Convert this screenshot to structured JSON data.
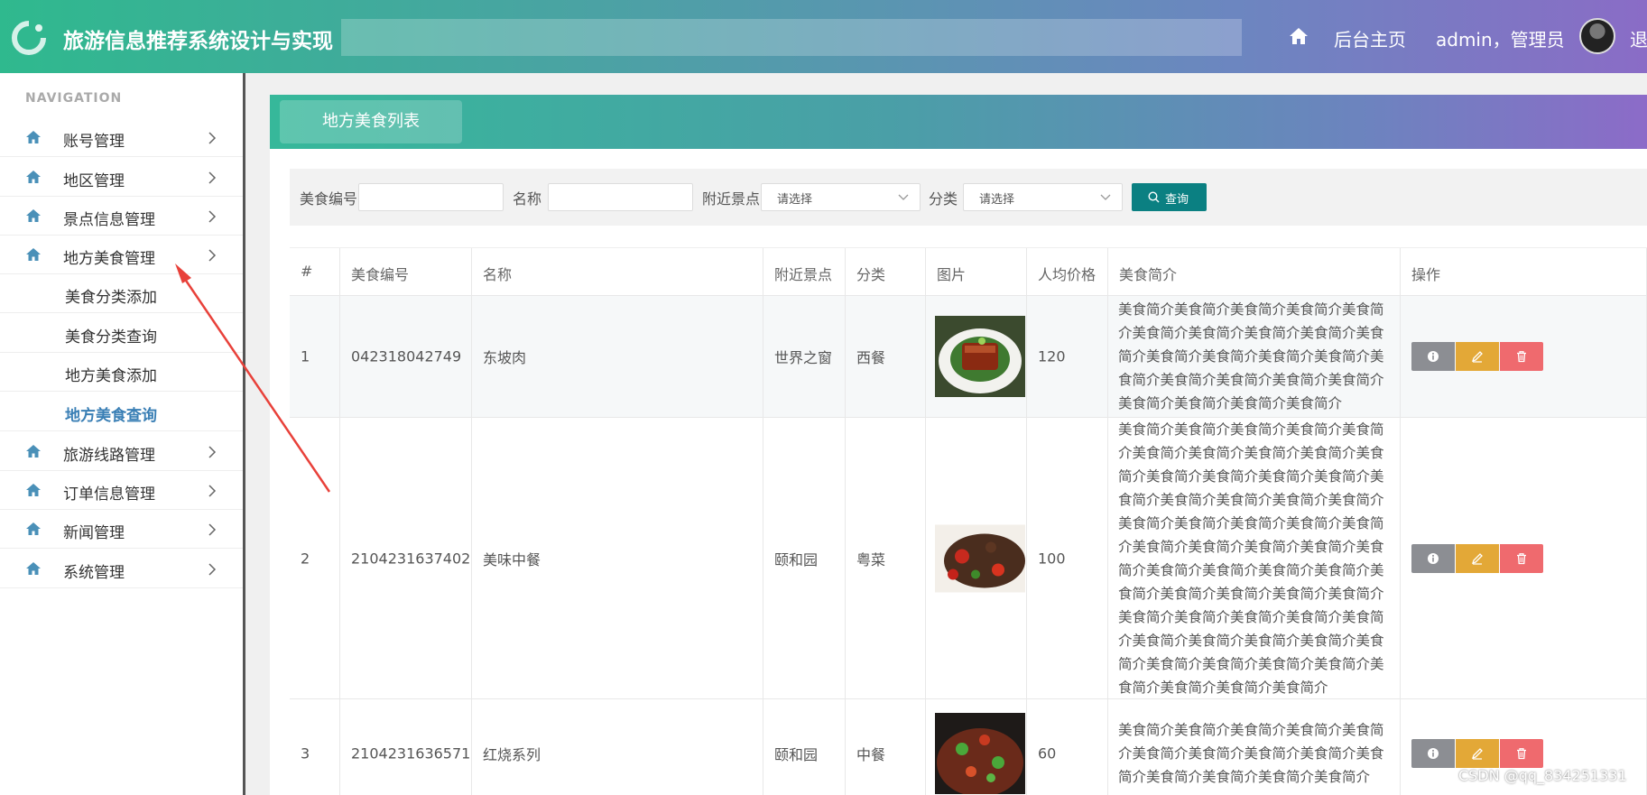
{
  "header": {
    "app_title": "旅游信息推荐系统设计与实现",
    "home_link": "后台主页",
    "user": "admin，管理员",
    "logout": "退"
  },
  "sidebar": {
    "heading": "NAVIGATION",
    "items": [
      {
        "label": "账号管理"
      },
      {
        "label": "地区管理"
      },
      {
        "label": "景点信息管理"
      },
      {
        "label": "地方美食管理"
      },
      {
        "label": "旅游线路管理"
      },
      {
        "label": "订单信息管理"
      },
      {
        "label": "新闻管理"
      },
      {
        "label": "系统管理"
      }
    ],
    "subitems": [
      {
        "label": "美食分类添加"
      },
      {
        "label": "美食分类查询"
      },
      {
        "label": "地方美食添加"
      },
      {
        "label": "地方美食查询",
        "active": true
      }
    ]
  },
  "tab": {
    "label": "地方美食列表"
  },
  "filters": {
    "code_label": "美食编号",
    "name_label": "名称",
    "spot_label": "附近景点",
    "spot_placeholder": "请选择",
    "category_label": "分类",
    "category_placeholder": "请选择",
    "search_label": "查询"
  },
  "table": {
    "headers": [
      "#",
      "美食编号",
      "名称",
      "附近景点",
      "分类",
      "图片",
      "人均价格",
      "美食简介",
      "操作"
    ],
    "rows": [
      {
        "index": "1",
        "code": "042318042749",
        "name": "东坡肉",
        "spot": "世界之窗",
        "category": "西餐",
        "price": "120",
        "description": "美食简介美食简介美食简介美食简介美食简介美食简介美食简介美食简介美食简介美食简介美食简介美食简介美食简介美食简介美食简介美食简介美食简介美食简介美食简介美食简介美食简介美食简介美食简介"
      },
      {
        "index": "2",
        "code": "2104231637402",
        "name": "美味中餐",
        "spot": "颐和园",
        "category": "粤菜",
        "price": "100",
        "description": "美食简介美食简介美食简介美食简介美食简介美食简介美食简介美食简介美食简介美食简介美食简介美食简介美食简介美食简介美食简介美食简介美食简介美食简介美食简介美食简介美食简介美食简介美食简介美食简介美食简介美食简介美食简介美食简介美食简介美食简介美食简介美食简介美食简介美食简介美食简介美食简介美食简介美食简介美食简介美食简介美食简介美食简介美食简介美食简介美食简介美食简介美食简介美食简介美食简介美食简介美食简介美食简介美食简介美食简介美食简介美食简介"
      },
      {
        "index": "3",
        "code": "2104231636571",
        "name": "红烧系列",
        "spot": "颐和园",
        "category": "中餐",
        "price": "60",
        "description": "美食简介美食简介美食简介美食简介美食简介美食简介美食简介美食简介美食简介美食简介美食简介美食简介美食简介美食简介"
      }
    ]
  },
  "watermark": "CSDN @qq_834251331",
  "colors": {
    "search_button": "#0b8082",
    "view_button": "#8c8e93",
    "edit_button": "#e3a837",
    "delete_button": "#ef6a6e",
    "active_nav": "#3a7fb5"
  }
}
